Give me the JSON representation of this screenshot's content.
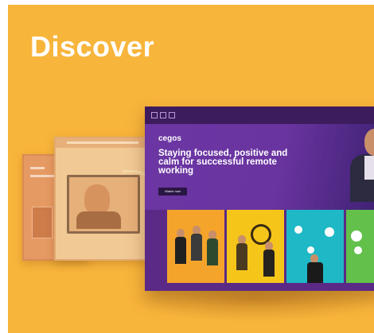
{
  "header": {
    "title": "Discover"
  },
  "front_window": {
    "logo": "cegos",
    "hero_title": "Staying focused, positive and calm for successful remote working",
    "cta_label": "Watch now"
  },
  "cards": [
    {
      "color": "#f4a42a"
    },
    {
      "color": "#f6c51a"
    },
    {
      "color": "#1fb8c6"
    },
    {
      "color": "#62c04b"
    }
  ],
  "colors": {
    "background": "#f8b53b",
    "brand_purple": "#5a2a86",
    "title_text": "#ffffff"
  }
}
